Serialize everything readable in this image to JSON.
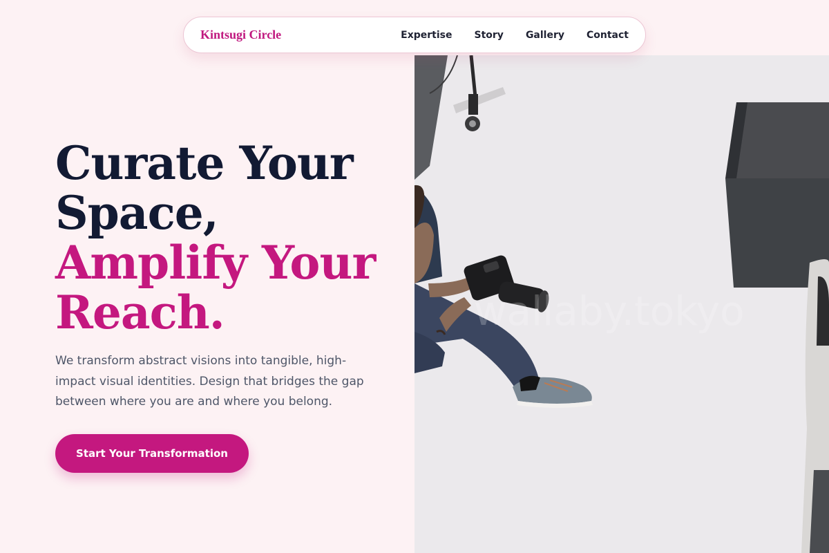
{
  "nav": {
    "brand": "Kintsugi Circle",
    "links": [
      "Expertise",
      "Story",
      "Gallery",
      "Contact"
    ]
  },
  "hero": {
    "title_line1": "Curate Your",
    "title_line2": "Space,",
    "title_line3": "Amplify Your",
    "title_line4": "Reach.",
    "description": "We transform abstract visions into tangible, high-impact visual identities. Design that bridges the gap between where you are and where you belong.",
    "cta_label": "Start Your Transformation",
    "photo_watermark": "wallaby.tokyo"
  },
  "colors": {
    "accent": "#c4187f",
    "heading": "#121a33",
    "background": "#fdf2f4"
  }
}
